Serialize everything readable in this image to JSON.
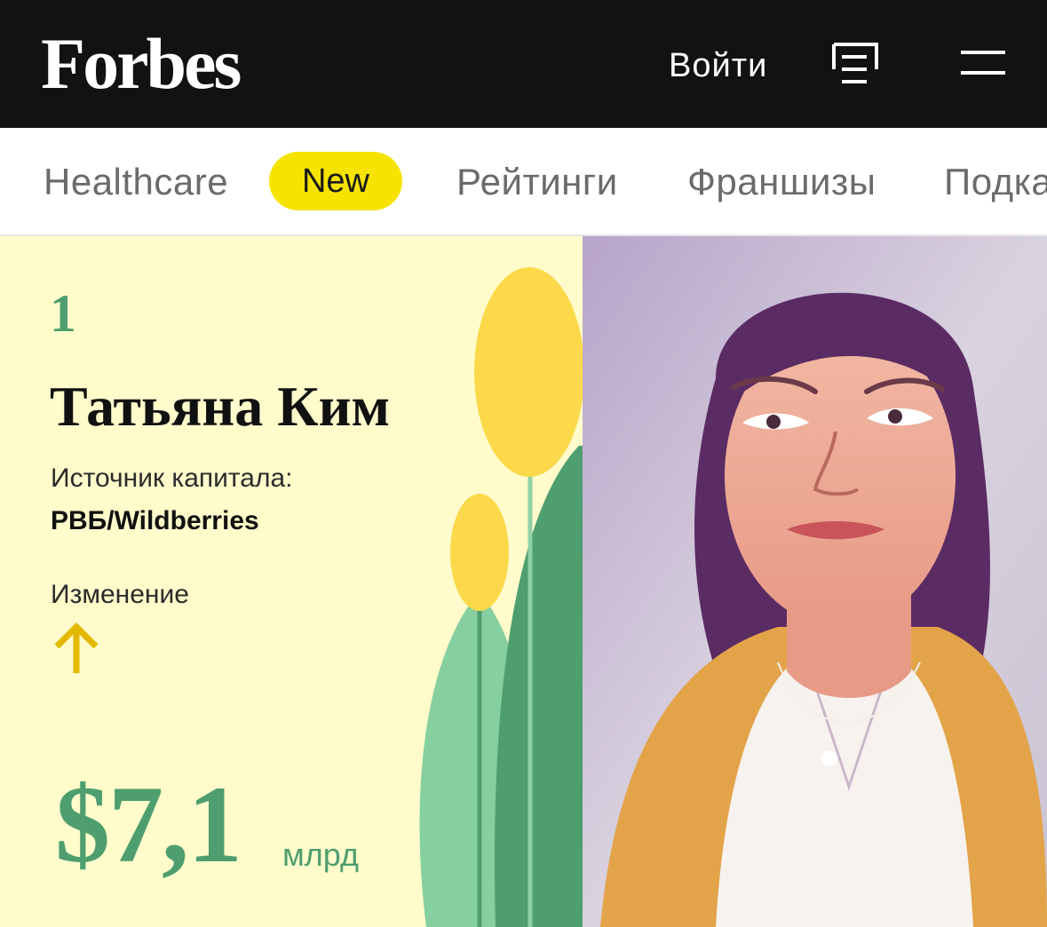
{
  "header": {
    "logo": "Forbes",
    "login_label": "Войти",
    "feed_icon": "news-feed-icon",
    "menu_icon": "hamburger-menu-icon"
  },
  "nav": {
    "items": [
      {
        "label": "Healthcare"
      },
      {
        "label": "Рейтинги"
      },
      {
        "label": "Франшизы"
      },
      {
        "label": "Подкасты"
      }
    ],
    "badge": "New"
  },
  "person": {
    "rank": "1",
    "name": "Татьяна Ким",
    "capital_source_label": "Источник капитала:",
    "capital_source": "РВБ/Wildberries",
    "change_label": "Изменение",
    "change_direction": "up",
    "net_worth": "$7,1",
    "net_worth_unit": "млрд"
  },
  "colors": {
    "header_bg": "#121212",
    "badge": "#f7e300",
    "panel_bg": "#fffbcb",
    "accent_green": "#4e9e6f",
    "arrow_yellow": "#e3b800"
  }
}
